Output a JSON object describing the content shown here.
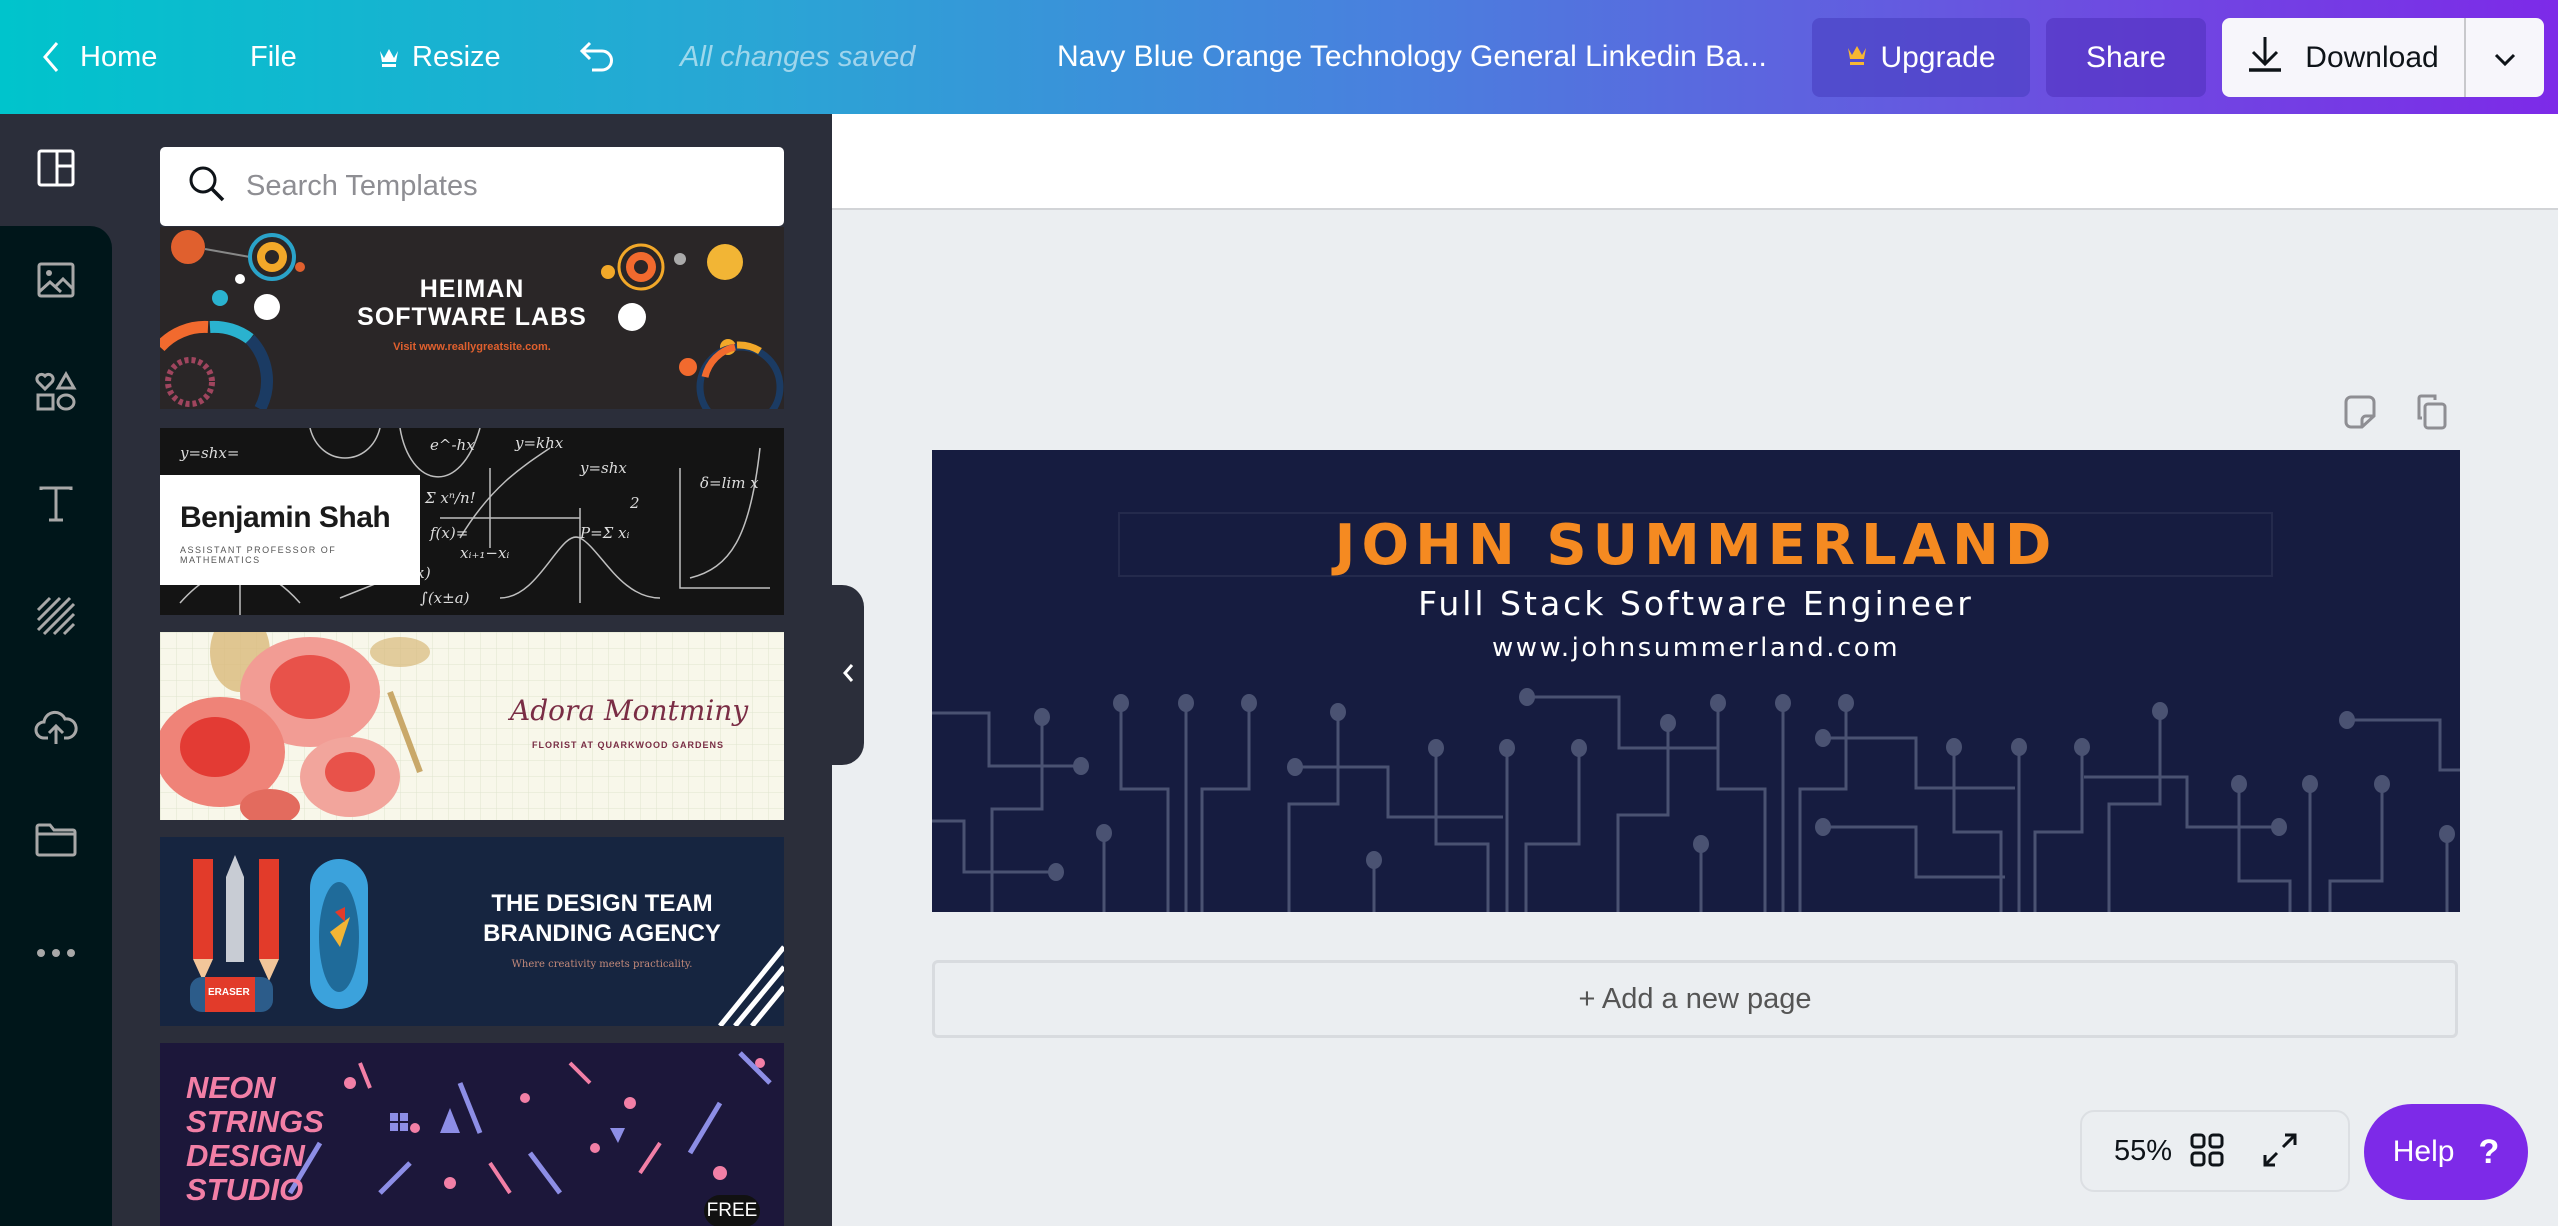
{
  "header": {
    "home_label": "Home",
    "file_label": "File",
    "resize_label": "Resize",
    "save_status": "All changes saved",
    "document_title": "Navy Blue Orange Technology General Linkedin Ba...",
    "upgrade_label": "Upgrade",
    "share_label": "Share",
    "download_label": "Download",
    "icons": {
      "back": "chevron-left-icon",
      "resize": "crown-icon",
      "undo": "undo-icon",
      "upgrade": "crown-icon",
      "download": "download-icon",
      "more": "chevron-down-icon"
    }
  },
  "sidebar": {
    "items": [
      {
        "id": "templates",
        "icon": "templates-layout-icon",
        "active": true
      },
      {
        "id": "photos",
        "icon": "image-icon",
        "active": false
      },
      {
        "id": "elements",
        "icon": "shapes-icon",
        "active": false
      },
      {
        "id": "text",
        "icon": "text-icon",
        "active": false
      },
      {
        "id": "background",
        "icon": "background-stripes-icon",
        "active": false
      },
      {
        "id": "uploads",
        "icon": "cloud-upload-icon",
        "active": false
      },
      {
        "id": "folders",
        "icon": "folder-icon",
        "active": false
      },
      {
        "id": "more",
        "icon": "more-dots-icon",
        "active": false
      }
    ]
  },
  "panel": {
    "search_placeholder": "Search Templates",
    "search_value": "",
    "templates": [
      {
        "title": "HEIMAN",
        "title2": "SOFTWARE LABS",
        "subtitle": "Visit www.reallygreatsite.com."
      },
      {
        "title": "Benjamin Shah",
        "subtitle": "ASSISTANT PROFESSOR OF MATHEMATICS"
      },
      {
        "title": "Adora Montminy",
        "subtitle": "FLORIST AT QUARKWOOD GARDENS"
      },
      {
        "title": "THE DESIGN TEAM",
        "title2": "BRANDING AGENCY",
        "subtitle": "Where creativity meets practicality.",
        "eraser_label": "ERASER"
      },
      {
        "title_lines": [
          "NEON",
          "STRINGS",
          "DESIGN",
          "STUDIO"
        ],
        "badge": "FREE"
      }
    ]
  },
  "canvas": {
    "name": "JOHN SUMMERLAND",
    "role": "Full Stack Software Engineer",
    "url": "www.johnsummerland.com",
    "background_color": "#161c40",
    "accent_color": "#f58a21"
  },
  "workspace": {
    "add_page_label": "+ Add a new page",
    "zoom_level": "55%",
    "help_label": "Help",
    "help_glyph": "?"
  },
  "colors": {
    "brand_purple": "#7d2ae8",
    "brand_teal": "#00c4cc",
    "panel_bg": "#2b2e3a",
    "sidebar_bg": "#00161a"
  }
}
